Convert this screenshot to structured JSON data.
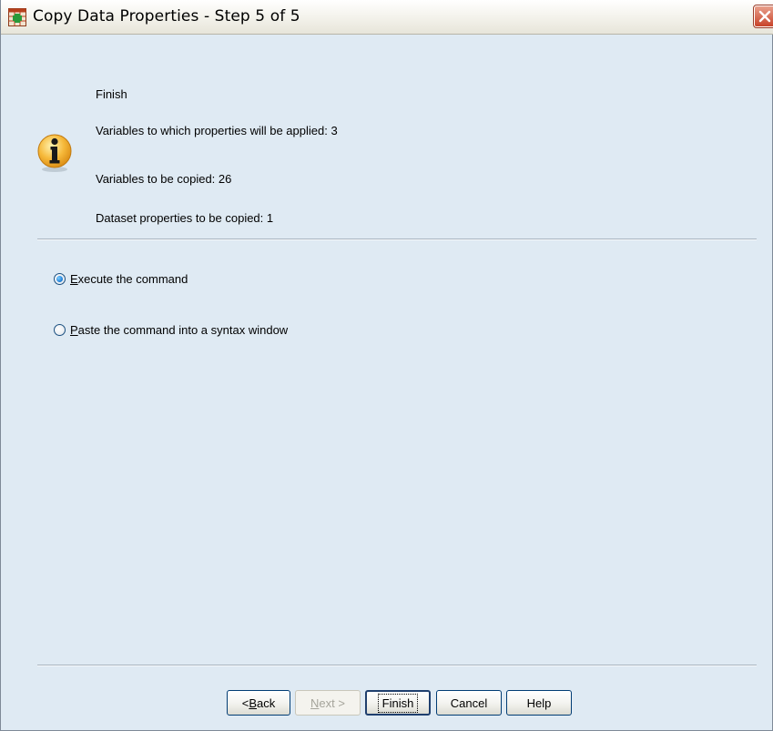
{
  "window": {
    "title": "Copy Data Properties - Step 5 of 5",
    "icon": "spss-data-icon",
    "close_icon": "close-icon"
  },
  "summary": {
    "heading": "Finish",
    "icon": "info-icon",
    "lines": [
      "Variables to which properties will be applied: 3",
      "Variables to be copied: 26",
      "Dataset properties to be copied: 1"
    ]
  },
  "options": {
    "selected": "execute",
    "execute": {
      "mnemonic": "E",
      "rest": "xecute the command"
    },
    "paste": {
      "mnemonic": "P",
      "rest": "aste the command into a syntax window"
    }
  },
  "buttons": {
    "back": {
      "prefix": "< ",
      "mnemonic": "B",
      "rest": "ack"
    },
    "next": {
      "mnemonic": "N",
      "rest": "ext >"
    },
    "finish": "Finish",
    "cancel": "Cancel",
    "help": "Help"
  },
  "colors": {
    "dialog_bg": "#dfeaf3",
    "button_border": "#003c74",
    "close_button": "#c8432a"
  }
}
